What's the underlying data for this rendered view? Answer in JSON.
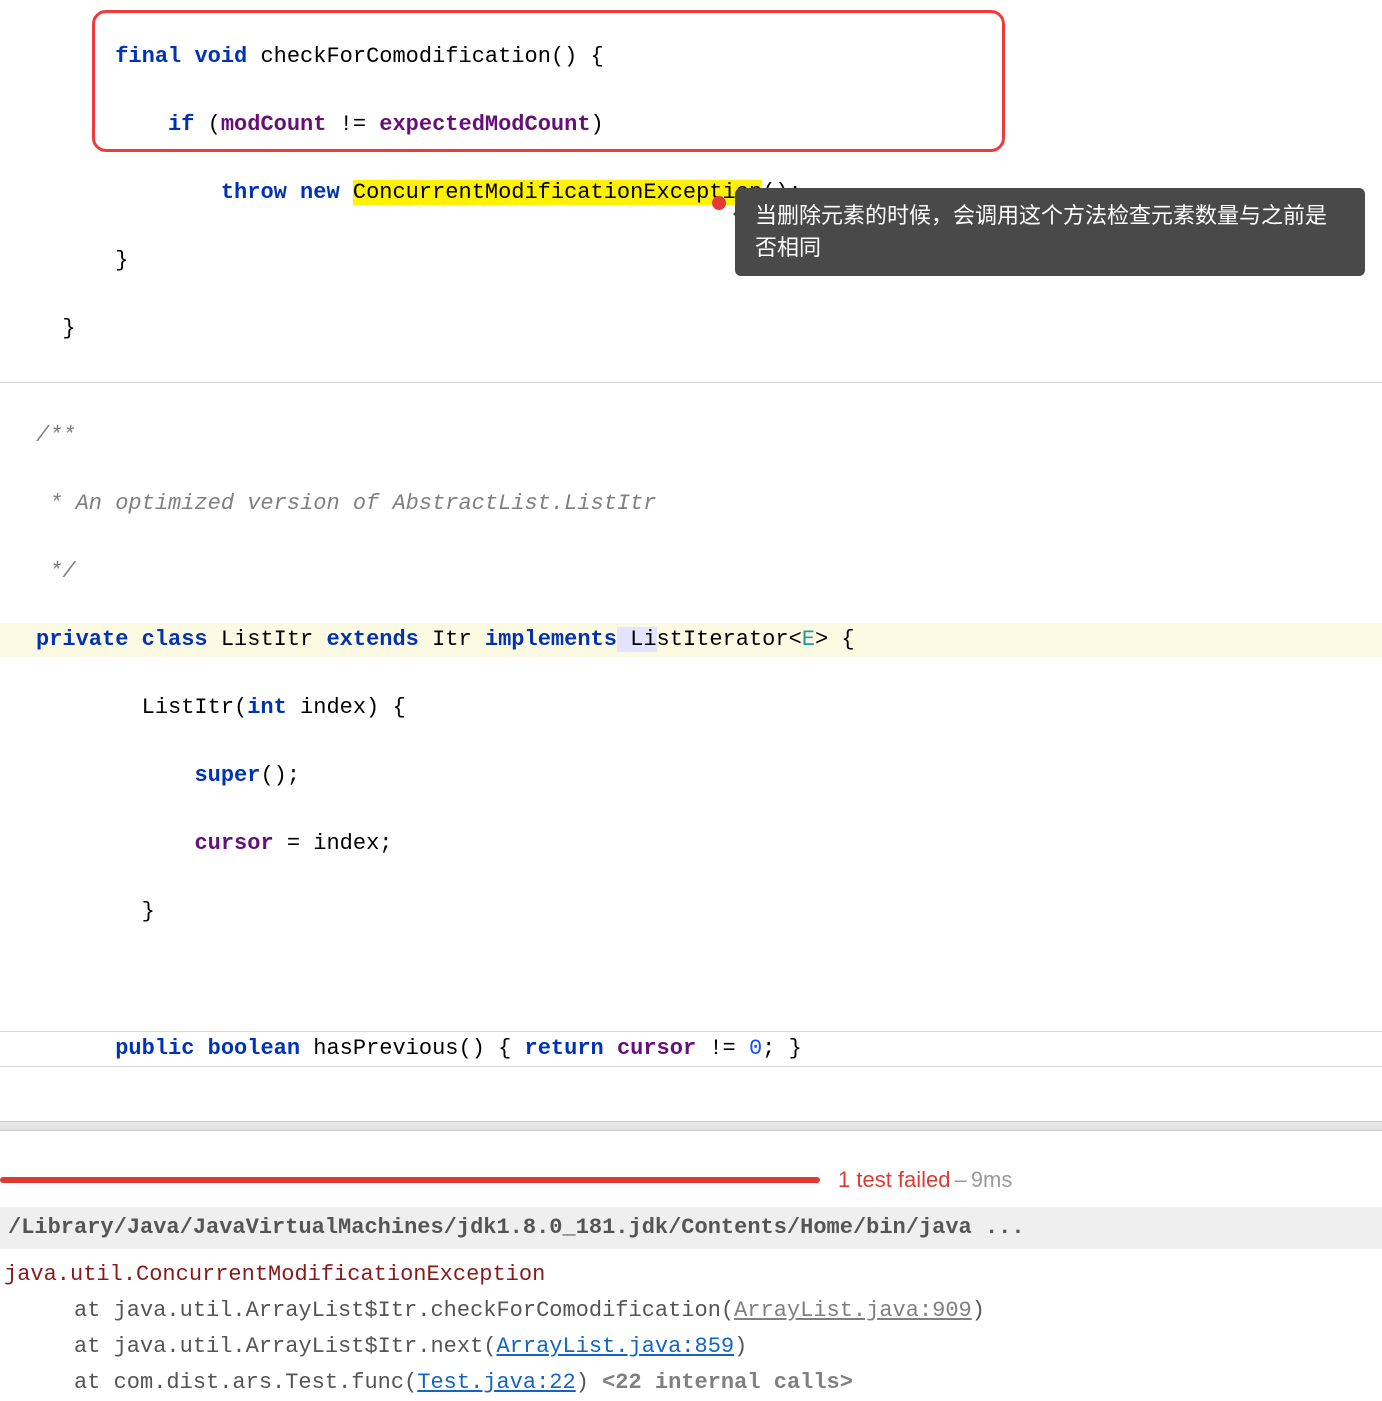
{
  "code": {
    "l1_final": "final",
    "l1_void": "void",
    "l1_method": "checkForComodification",
    "l1_rest": "() {",
    "l2_if": "if",
    "l2_open": " (",
    "l2_mod": "modCount",
    "l2_neq": " != ",
    "l2_exp": "expectedModCount",
    "l2_close": ")",
    "l3_throw": "throw",
    "l3_new": " new ",
    "l3_exc": "ConcurrentModificationException",
    "l3_rest": "();",
    "l4": "}",
    "l5": "}",
    "c1": "/**",
    "c2": " * An optimized version of AbstractList.ListItr",
    "c3": " */",
    "d_priv": "private",
    "d_class": " class ",
    "d_name": "ListItr ",
    "d_ext": "extends",
    "d_itr": " Itr ",
    "d_impl": "implements",
    "d_li": " Li",
    "d_li2": "stIterator",
    "d_gen_open": "<",
    "d_gen": "E",
    "d_gen_close": ">",
    "d_brace": " {",
    "e1": "        ListItr(",
    "e1_int": "int",
    "e1_rest": " index) {",
    "e2_super": "super",
    "e2_rest": "();",
    "e3_cursor": "cursor",
    "e3_rest": " = index;",
    "e4": "        }",
    "f_pub": "public",
    "f_bool": " boolean ",
    "f_name": "hasPrevious() ",
    "f_open": "{ ",
    "f_ret": "return",
    "f_sp": " ",
    "f_cur": "cursor",
    "f_neq": " != ",
    "f_zero": "0",
    "f_end": "; }"
  },
  "tooltip": "当删除元素的时候，会调用这个方法检查元素数量与之前是否相同",
  "test": {
    "status": "1 test failed",
    "dash": " – ",
    "time": "9ms"
  },
  "console": {
    "cmd": "/Library/Java/JavaVirtualMachines/jdk1.8.0_181.jdk/Contents/Home/bin/java ...",
    "exc": "java.util.ConcurrentModificationException",
    "t1a": "at java.util.ArrayList$Itr.checkForComodification(",
    "t1link": "ArrayList.java:909",
    "t1b": ")",
    "t2a": "at java.util.ArrayList$Itr.next(",
    "t2link": "ArrayList.java:859",
    "t2b": ")",
    "t3a": "at com.dist.ars.Test.func(",
    "t3link": "Test.java:22",
    "t3b": ") ",
    "t3gray": "<22 internal calls>"
  }
}
